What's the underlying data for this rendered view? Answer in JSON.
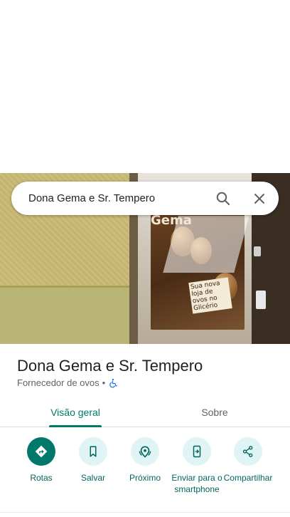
{
  "search": {
    "query": "Dona Gema e Sr. Tempero"
  },
  "photo": {
    "poster_title": "Gema",
    "poster_text": "Sua nova loja de ovos no Glicério"
  },
  "place": {
    "name": "Dona Gema e Sr. Tempero",
    "category": "Fornecedor de ovos",
    "separator": "•"
  },
  "tabs": [
    {
      "label": "Visão geral",
      "selected": true
    },
    {
      "label": "Sobre",
      "selected": false
    }
  ],
  "actions": [
    {
      "label": "Rotas",
      "icon": "directions-icon"
    },
    {
      "label": "Salvar",
      "icon": "bookmark-icon"
    },
    {
      "label": "Próximo",
      "icon": "nearby-icon"
    },
    {
      "label": "Enviar para o smartphone",
      "icon": "send-to-phone-icon"
    },
    {
      "label": "Compartilhar",
      "icon": "share-icon"
    }
  ],
  "colors": {
    "accent": "#00796b",
    "action_bg": "#e0f4f5",
    "accessibility": "#1a73e8"
  }
}
